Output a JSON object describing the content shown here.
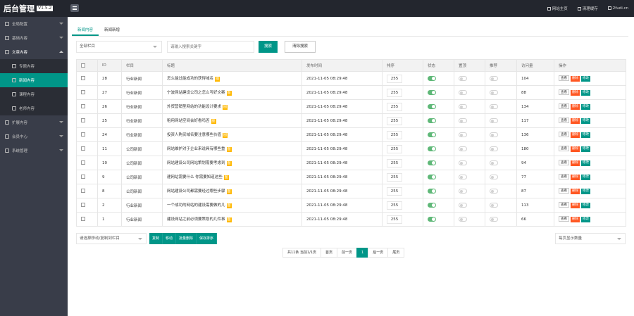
{
  "app": {
    "title": "后台管理",
    "version": "V1.5.2"
  },
  "topbar": {
    "home": "网站主页",
    "clear_cache": "清理缓存",
    "user": "2fudi.cn"
  },
  "sidebar": {
    "items": [
      {
        "label": "全局配置"
      },
      {
        "label": "基础内容"
      },
      {
        "label": "文章内容"
      },
      {
        "label": "专题内容"
      },
      {
        "label": "新闻内容"
      },
      {
        "label": "课程内容"
      },
      {
        "label": "老师内容"
      },
      {
        "label": "扩展内容"
      },
      {
        "label": "会员中心"
      },
      {
        "label": "系统管理"
      }
    ]
  },
  "tabs": [
    "新闻内容",
    "新闻新增"
  ],
  "filter": {
    "category_select": "全部栏目",
    "keyword_placeholder": "请输入搜索关键字",
    "search_label": "搜索",
    "clear_label": "清除搜索"
  },
  "table": {
    "headers": [
      "ID",
      "栏目",
      "标题",
      "发布时间",
      "排序",
      "状态",
      "置顶",
      "推荐",
      "访问量",
      "操作"
    ],
    "tag_label": "图",
    "ops": [
      "查看",
      "删除",
      "修改"
    ],
    "rows": [
      {
        "id": "28",
        "cat": "行业新闻",
        "title": "怎么能过能成功的获得域名",
        "time": "2021-11-05 08:29:48",
        "sort": "255",
        "status": true,
        "top": false,
        "rec": false,
        "visits": "104"
      },
      {
        "id": "27",
        "cat": "行业新闻",
        "title": "宁波网站建设公司之怎么写好文案",
        "time": "2021-11-05 08:29:48",
        "sort": "255",
        "status": true,
        "top": false,
        "rec": false,
        "visits": "88"
      },
      {
        "id": "26",
        "cat": "行业新闻",
        "title": "外贸营销型网站的功能设计要求",
        "time": "2021-11-05 08:29:48",
        "sort": "255",
        "status": true,
        "top": false,
        "rec": false,
        "visits": "134"
      },
      {
        "id": "25",
        "cat": "行业新闻",
        "title": "租用网站空间会好看吗否",
        "time": "2021-11-05 08:29:48",
        "sort": "255",
        "status": true,
        "top": false,
        "rec": false,
        "visits": "117"
      },
      {
        "id": "24",
        "cat": "行业新闻",
        "title": "投资人购买域名要注意哪些价值",
        "time": "2021-11-05 08:29:48",
        "sort": "255",
        "status": true,
        "top": false,
        "rec": false,
        "visits": "136"
      },
      {
        "id": "11",
        "cat": "公司新闻",
        "title": "网站维护对于企业来说具有哪些重",
        "time": "2021-11-05 08:29:48",
        "sort": "255",
        "status": true,
        "top": false,
        "rec": false,
        "visits": "180"
      },
      {
        "id": "10",
        "cat": "公司新闻",
        "title": "网站建设公司网站策划需要考虑到",
        "time": "2021-11-05 08:29:48",
        "sort": "255",
        "status": true,
        "top": false,
        "rec": false,
        "visits": "94"
      },
      {
        "id": "9",
        "cat": "公司新闻",
        "title": "建网站需要什么 你需要知道这些",
        "time": "2021-11-05 08:29:48",
        "sort": "255",
        "status": true,
        "top": false,
        "rec": false,
        "visits": "77"
      },
      {
        "id": "8",
        "cat": "公司新闻",
        "title": "网站建设公司都需要经过哪些步骤",
        "time": "2021-11-05 08:29:48",
        "sort": "255",
        "status": true,
        "top": false,
        "rec": false,
        "visits": "87"
      },
      {
        "id": "2",
        "cat": "行业新闻",
        "title": "一个成功的网站的建设需要做的几",
        "time": "2021-11-05 08:29:48",
        "sort": "255",
        "status": true,
        "top": false,
        "rec": false,
        "visits": "113"
      },
      {
        "id": "1",
        "cat": "行业新闻",
        "title": "建设网站之前必须要策划的几件事",
        "time": "2021-11-05 08:29:48",
        "sort": "255",
        "status": true,
        "top": false,
        "rec": false,
        "visits": "66"
      }
    ]
  },
  "batch": {
    "select": "请选择移动/复制到栏目",
    "buttons": [
      "复制",
      "移动",
      "批量删除",
      "保存排序"
    ]
  },
  "pager": {
    "info": "共11条 当前1/1页",
    "first": "首页",
    "prev": "前一页",
    "current": "1",
    "next": "后一页",
    "last": "尾页"
  },
  "per_page": "每页显示数量"
}
